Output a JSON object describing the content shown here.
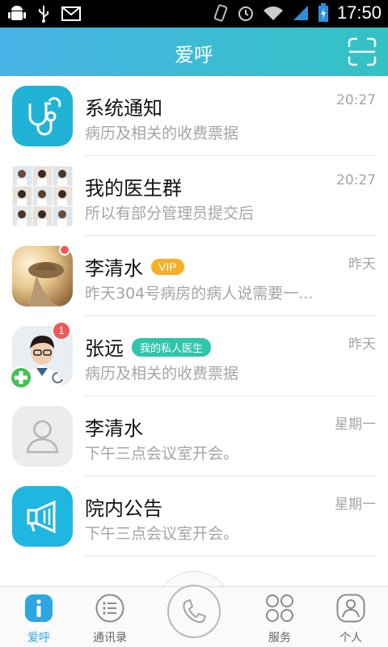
{
  "status_bar": {
    "time": "17:50",
    "icons": [
      "android-debug-icon",
      "usb-icon",
      "gmail-icon",
      "vibrate-icon",
      "alarm-icon",
      "wifi-icon",
      "signal-icon",
      "battery-charging-icon"
    ]
  },
  "header": {
    "title": "爱呼",
    "right_icon": "scan-icon"
  },
  "conversations": [
    {
      "name": "系统通知",
      "preview": "病历及相关的收费票据",
      "time": "20:27",
      "avatar_icon": "stethoscope-icon",
      "avatar_color": "#20b3d6"
    },
    {
      "name": "我的医生群",
      "preview": "所以有部分管理员提交后",
      "time": "20:27",
      "avatar_icon": "group-collage"
    },
    {
      "name": "李清水",
      "tag": "VIP",
      "preview": "昨天304号病房的病人说需要一...",
      "time": "昨天",
      "avatar_icon": "photo-avatar",
      "unread_dot": true
    },
    {
      "name": "张远",
      "tag": "我的私人医生",
      "preview": "病历及相关的收费票据",
      "time": "昨天",
      "avatar_icon": "doctor-photo-avatar",
      "badge": "1"
    },
    {
      "name": "李清水",
      "preview": "下午三点会议室开会。",
      "time": "星期一",
      "avatar_icon": "default-user-icon"
    },
    {
      "name": "院内公告",
      "preview": "下午三点会议室开会。",
      "time": "星期一",
      "avatar_icon": "megaphone-icon",
      "avatar_color": "#1fb6df"
    }
  ],
  "bottom_nav": {
    "items": [
      {
        "label": "爱呼",
        "icon": "info-icon",
        "active": true
      },
      {
        "label": "通讯录",
        "icon": "contacts-list-icon"
      },
      {
        "label": "",
        "icon": "phone-icon"
      },
      {
        "label": "服务",
        "icon": "services-grid-icon"
      },
      {
        "label": "个人",
        "icon": "profile-icon"
      }
    ]
  },
  "colors": {
    "header_start": "#48b3e6",
    "header_end": "#33c2c4",
    "vip_tag": "#f5b026",
    "doctor_tag": "#30c6ab",
    "badge": "#f05a5a",
    "active_nav": "#2ea7e0"
  }
}
